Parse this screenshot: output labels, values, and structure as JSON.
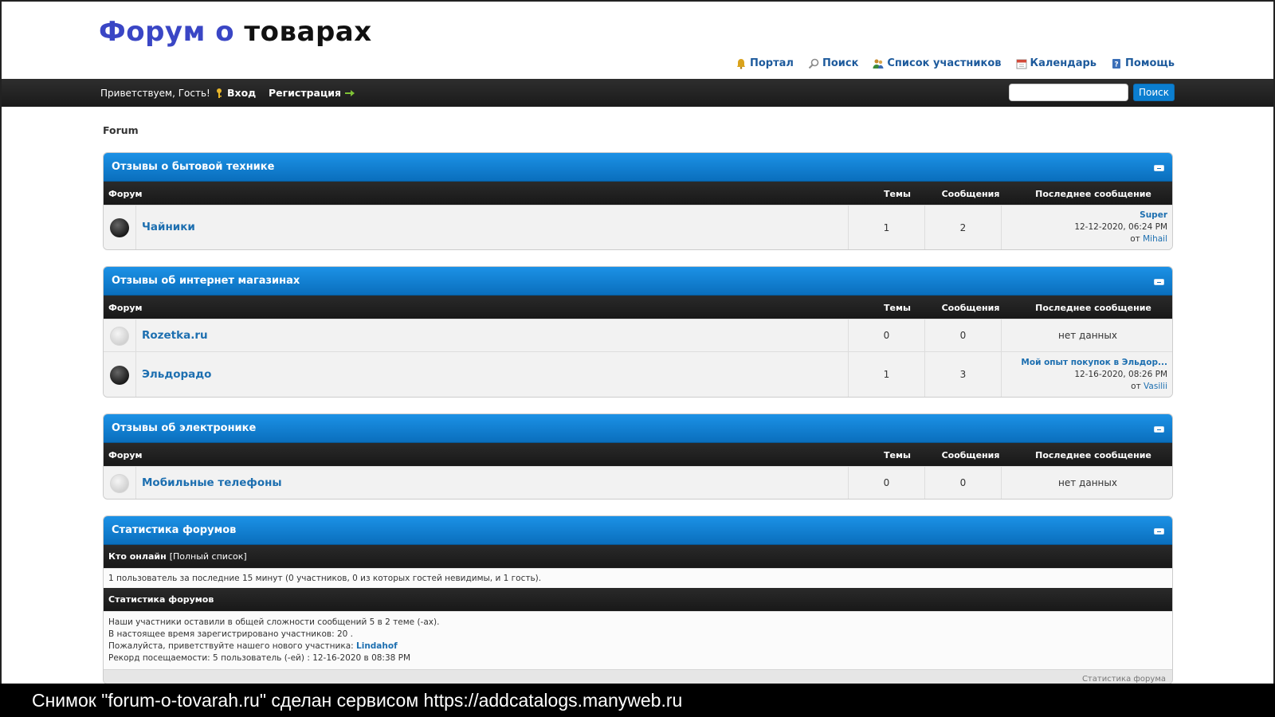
{
  "logo": {
    "part1": "Форум о",
    "part2": "товарах"
  },
  "toplinks": [
    {
      "label": "Портал",
      "icon": "bell-icon",
      "color": "#d9a21b"
    },
    {
      "label": "Поиск",
      "icon": "magnifier-icon",
      "color": "#888888"
    },
    {
      "label": "Список участников",
      "icon": "users-icon",
      "color": "#c68a2c"
    },
    {
      "label": "Календарь",
      "icon": "calendar-icon",
      "color": "#d24a3a"
    },
    {
      "label": "Помощь",
      "icon": "help-icon",
      "color": "#3b6fb8"
    }
  ],
  "navbar": {
    "greeting": "Приветствуем, Гость!",
    "login": "Вход",
    "register": "Регистрация",
    "search_button": "Поиск",
    "search_placeholder": ""
  },
  "breadcrumb": "Forum",
  "columns": {
    "forum": "Форум",
    "topics": "Темы",
    "posts": "Сообщения",
    "last": "Последнее сообщение"
  },
  "categories": [
    {
      "title": "Отзывы о бытовой технике",
      "forums": [
        {
          "name": "Чайники",
          "status": "new",
          "topics": "1",
          "posts": "2",
          "last": {
            "title": "Super",
            "date": "12-12-2020, 06:24 PM",
            "by_prefix": "от",
            "by": "Mihail"
          }
        }
      ]
    },
    {
      "title": "Отзывы об интернет магазинах",
      "forums": [
        {
          "name": "Rozetka.ru",
          "status": "none",
          "topics": "0",
          "posts": "0",
          "last_empty": "нет данных"
        },
        {
          "name": "Эльдорадо",
          "status": "new",
          "topics": "1",
          "posts": "3",
          "last": {
            "title": "Мой опыт покупок в Эльдор...",
            "date": "12-16-2020, 08:26 PM",
            "by_prefix": "от",
            "by": "Vasilii"
          }
        }
      ]
    },
    {
      "title": "Отзывы об электронике",
      "forums": [
        {
          "name": "Мобильные телефоны",
          "status": "none",
          "topics": "0",
          "posts": "0",
          "last_empty": "нет данных"
        }
      ]
    }
  ],
  "stats": {
    "title": "Статистика форумов",
    "online_label": "Кто онлайн",
    "online_link": "[Полный список]",
    "online_text": "1 пользователь за последние 15 минут (0 участников, 0 из которых гостей невидимы, и 1 гость).",
    "sub_title": "Статистика форумов",
    "line1": "Наши участники оставили в общей сложности сообщений 5 в 2 теме (-ах).",
    "line2": "В настоящее время зарегистрировано участников: 20 .",
    "line3_prefix": "Пожалуйста, приветствуйте нашего нового участника:",
    "new_user": "Lindahof",
    "line4": "Рекорд посещаемости: 5 пользователь (-ей) : 12-16-2020 в 08:38 PM",
    "footer": "Статистика форума"
  },
  "caption": "Снимок \"forum-o-tovarah.ru\" сделан сервисом https://addcatalogs.manyweb.ru"
}
